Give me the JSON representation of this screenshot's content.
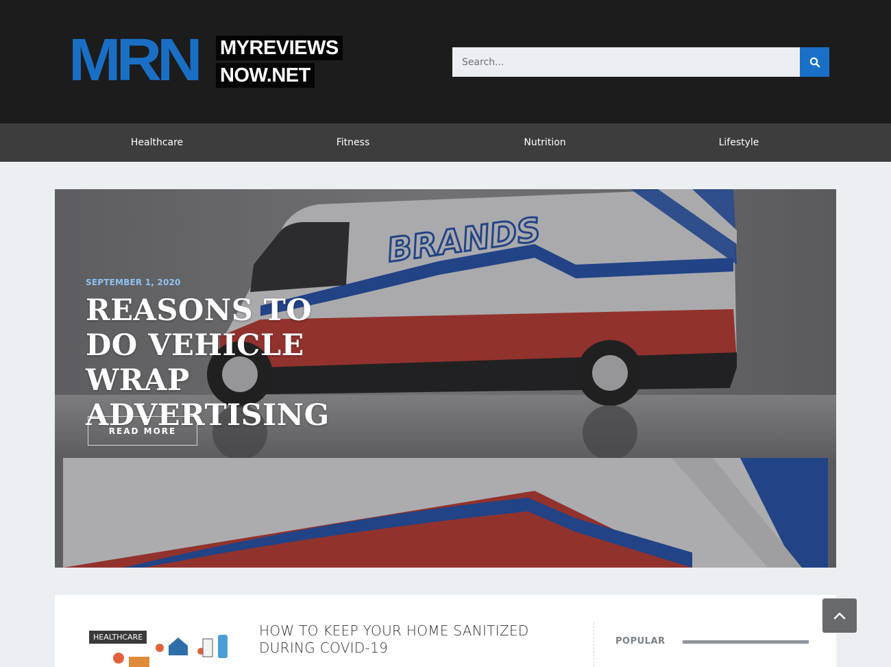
{
  "brand": {
    "logo_mark": "MRN",
    "logo_line1": "MYREVIEWS",
    "logo_line2": "NOW.NET",
    "accent_color": "#1a6fc4"
  },
  "search": {
    "placeholder": "Search...",
    "button_icon": "search-icon"
  },
  "nav": {
    "items": [
      {
        "label": "Healthcare"
      },
      {
        "label": "Fitness"
      },
      {
        "label": "Nutrition"
      },
      {
        "label": "Lifestyle"
      }
    ]
  },
  "hero": {
    "date": "SEPTEMBER 1, 2020",
    "title": "REASONS TO DO VEHICLE WRAP ADVERTISING",
    "button_label": "READ MORE",
    "image_text": "BRANDS"
  },
  "posts": [
    {
      "category": "HEALTHCARE",
      "title": "HOW TO KEEP YOUR HOME SANITIZED DURING COVID-19"
    }
  ],
  "sidebar": {
    "popular_label": "POPULAR"
  },
  "scroll_top": {
    "icon": "chevron-up-icon"
  }
}
